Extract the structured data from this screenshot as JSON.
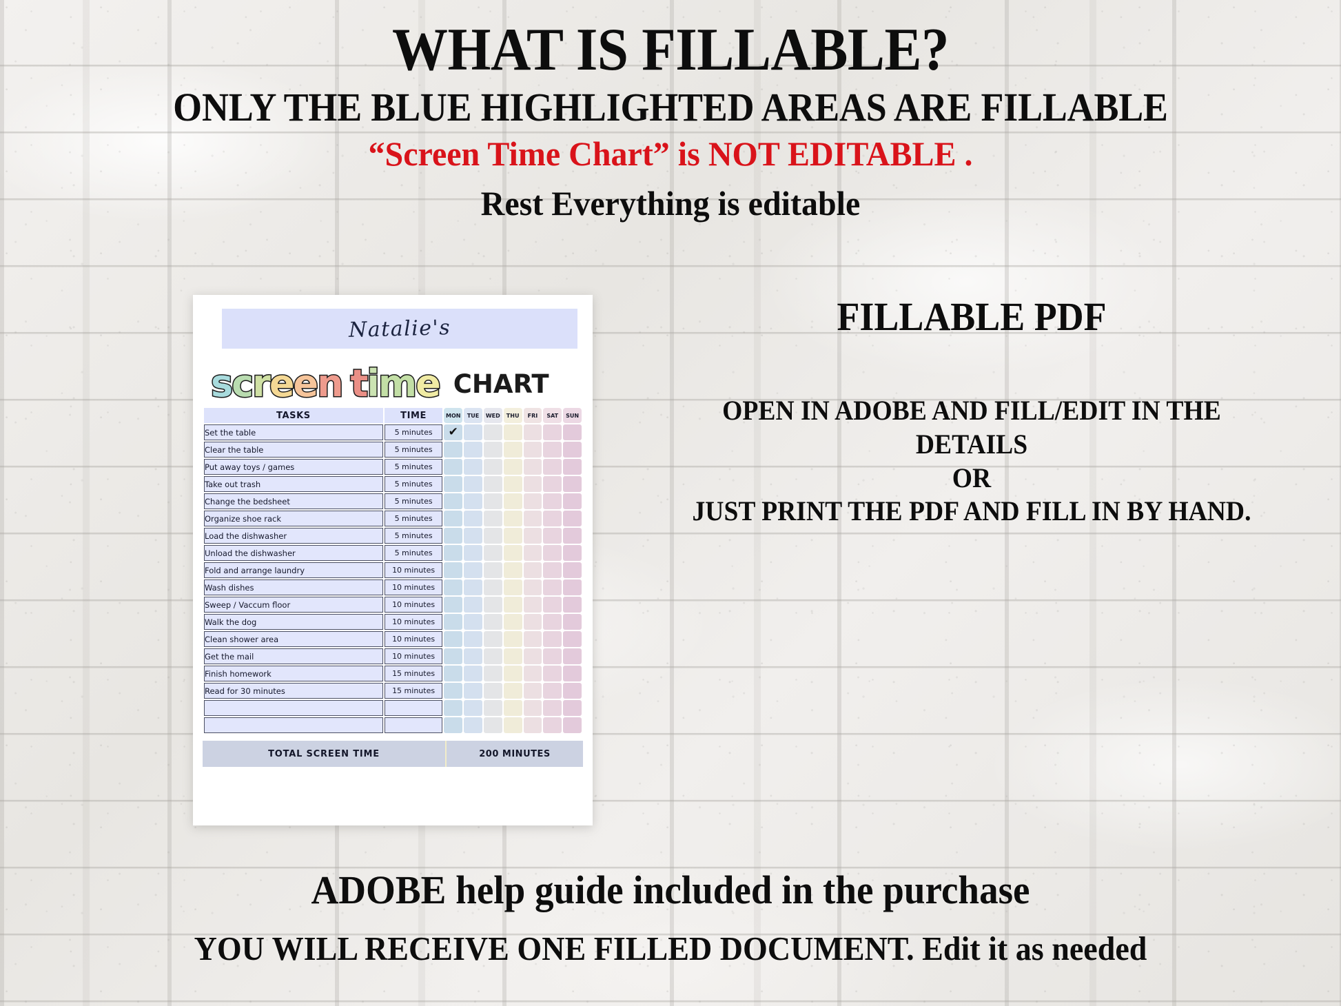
{
  "headings": {
    "title": "WHAT IS FILLABLE?",
    "subtitle": "ONLY THE BLUE HIGHLIGHTED AREAS ARE FILLABLE",
    "red_note": "“Screen Time Chart” is NOT EDITABLE .",
    "rest_note": "Rest Everything is editable"
  },
  "right_copy": {
    "fillable_pdf": "FILLABLE PDF",
    "instruction_lines": [
      "OPEN IN ADOBE AND FILL/EDIT IN THE",
      "DETAILS",
      "OR",
      "JUST PRINT THE PDF AND FILL IN BY HAND."
    ]
  },
  "bottom_copy": {
    "line1": "ADOBE help guide included in the purchase",
    "line2": "YOU WILL RECEIVE ONE FILLED DOCUMENT. Edit it as needed"
  },
  "chart": {
    "owner_name": "Natalie's",
    "title_word1": "screen",
    "title_word2": "time",
    "title_word3": "CHART",
    "title_colors_word1": [
      "#a8dbdd",
      "#b9dcb0",
      "#cfe0a4",
      "#f4d894",
      "#f6c49a",
      "#ee9b8d"
    ],
    "title_colors_word2": [
      "#ea8f86",
      "#cbe3b2",
      "#c3dfa6",
      "#f0eba4"
    ],
    "headers": {
      "tasks": "TASKS",
      "time": "TIME"
    },
    "days": [
      {
        "label": "MON",
        "header_bg": "#cfe4ee",
        "cell_bg": "#c9dcea"
      },
      {
        "label": "TUE",
        "header_bg": "#dbe4f2",
        "cell_bg": "#d4e0ef"
      },
      {
        "label": "WED",
        "header_bg": "#e6e7ee",
        "cell_bg": "#e4e5e7"
      },
      {
        "label": "THU",
        "header_bg": "#f3efdd",
        "cell_bg": "#f0ecd9"
      },
      {
        "label": "FRI",
        "header_bg": "#efe3e3",
        "cell_bg": "#ecdfe2"
      },
      {
        "label": "SAT",
        "header_bg": "#efdfe6",
        "cell_bg": "#e8d4df"
      },
      {
        "label": "SUN",
        "header_bg": "#ecd8e4",
        "cell_bg": "#e3cadb"
      }
    ],
    "rows": [
      {
        "task": "Set the table",
        "time": "5 minutes",
        "checks": [
          true,
          false,
          false,
          false,
          false,
          false,
          false
        ]
      },
      {
        "task": "Clear the table",
        "time": "5 minutes",
        "checks": [
          false,
          false,
          false,
          false,
          false,
          false,
          false
        ]
      },
      {
        "task": "Put away toys / games",
        "time": "5 minutes",
        "checks": [
          false,
          false,
          false,
          false,
          false,
          false,
          false
        ]
      },
      {
        "task": "Take out trash",
        "time": "5 minutes",
        "checks": [
          false,
          false,
          false,
          false,
          false,
          false,
          false
        ]
      },
      {
        "task": "Change the bedsheet",
        "time": "5 minutes",
        "checks": [
          false,
          false,
          false,
          false,
          false,
          false,
          false
        ]
      },
      {
        "task": "Organize shoe rack",
        "time": "5 minutes",
        "checks": [
          false,
          false,
          false,
          false,
          false,
          false,
          false
        ]
      },
      {
        "task": "Load the dishwasher",
        "time": "5 minutes",
        "checks": [
          false,
          false,
          false,
          false,
          false,
          false,
          false
        ]
      },
      {
        "task": "Unload the dishwasher",
        "time": "5 minutes",
        "checks": [
          false,
          false,
          false,
          false,
          false,
          false,
          false
        ]
      },
      {
        "task": "Fold and arrange laundry",
        "time": "10 minutes",
        "checks": [
          false,
          false,
          false,
          false,
          false,
          false,
          false
        ]
      },
      {
        "task": "Wash dishes",
        "time": "10 minutes",
        "checks": [
          false,
          false,
          false,
          false,
          false,
          false,
          false
        ]
      },
      {
        "task": "Sweep / Vaccum floor",
        "time": "10 minutes",
        "checks": [
          false,
          false,
          false,
          false,
          false,
          false,
          false
        ]
      },
      {
        "task": "Walk the dog",
        "time": "10 minutes",
        "checks": [
          false,
          false,
          false,
          false,
          false,
          false,
          false
        ]
      },
      {
        "task": "Clean shower area",
        "time": "10 minutes",
        "checks": [
          false,
          false,
          false,
          false,
          false,
          false,
          false
        ]
      },
      {
        "task": "Get the mail",
        "time": "10 minutes",
        "checks": [
          false,
          false,
          false,
          false,
          false,
          false,
          false
        ]
      },
      {
        "task": "Finish homework",
        "time": "15 minutes",
        "checks": [
          false,
          false,
          false,
          false,
          false,
          false,
          false
        ]
      },
      {
        "task": "Read for 30 minutes",
        "time": "15 minutes",
        "checks": [
          false,
          false,
          false,
          false,
          false,
          false,
          false
        ]
      },
      {
        "task": "",
        "time": "",
        "checks": [
          false,
          false,
          false,
          false,
          false,
          false,
          false
        ]
      },
      {
        "task": "",
        "time": "",
        "checks": [
          false,
          false,
          false,
          false,
          false,
          false,
          false
        ]
      }
    ],
    "total_label": "TOTAL SCREEN TIME",
    "total_value": "200 MINUTES",
    "check_glyph": "✔"
  },
  "colors": {
    "fillable_blue": "#dbe0fa",
    "red_accent": "#d9131a",
    "ink": "#0d0d0d"
  }
}
